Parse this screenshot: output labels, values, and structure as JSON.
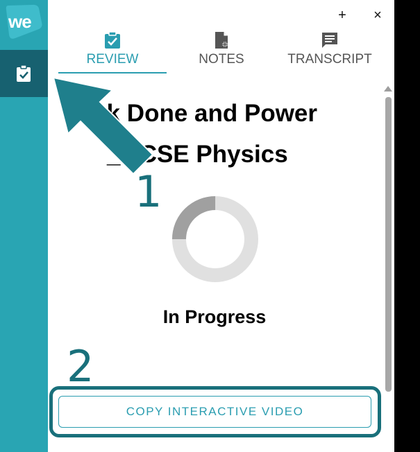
{
  "app": {
    "logo_text": "we",
    "colors": {
      "teal": "#29a5b3",
      "dark_teal": "#176170",
      "accent": "#2a9db0",
      "annotation": "#19707b"
    }
  },
  "window": {
    "add_label": "+",
    "close_label": "×"
  },
  "tabs": [
    {
      "label": "REVIEW",
      "icon": "clipboard-check-icon",
      "active": true
    },
    {
      "label": "NOTES",
      "icon": "note-add-icon",
      "active": false
    },
    {
      "label": "TRANSCRIPT",
      "icon": "message-lines-icon",
      "active": false
    }
  ],
  "content": {
    "title_line1": "rk Done and Power",
    "title_line2": "_GCSE Physics",
    "progress_fraction": 0.25,
    "status": "In Progress"
  },
  "actions": {
    "copy_label": "COPY INTERACTIVE VIDEO"
  },
  "annotations": {
    "step1": "1",
    "step2": "2"
  }
}
